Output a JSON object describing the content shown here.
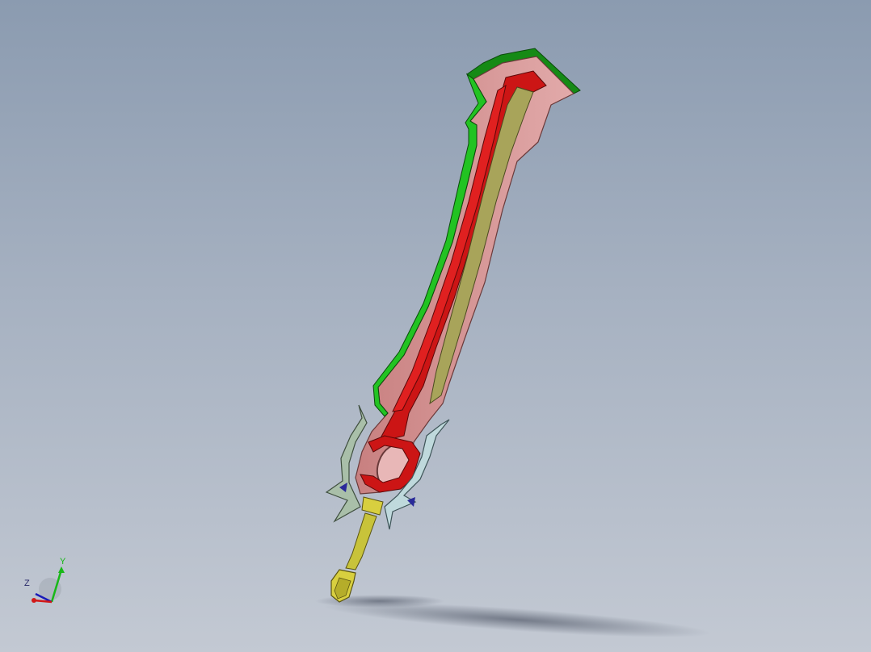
{
  "viewport": {
    "background_top": "#8b9bb0",
    "background_bottom": "#c3c9d3"
  },
  "model": {
    "name": "sword",
    "colors": {
      "blade_face": "#d79595",
      "blade_edge_green": "#22c322",
      "blade_dark_green": "#158a15",
      "inner_red": "#cc1515",
      "inner_olive": "#a8a45a",
      "guard_left": "#a9bfa9",
      "guard_right": "#bfd9dc",
      "grip": "#c8c33a",
      "pommel": "#d8cf3f"
    }
  },
  "triad": {
    "x_label": "X",
    "y_label": "Y",
    "z_label": "Z",
    "x_color": "#d11818",
    "y_color": "#18b818",
    "z_color": "#1a1ab8"
  }
}
